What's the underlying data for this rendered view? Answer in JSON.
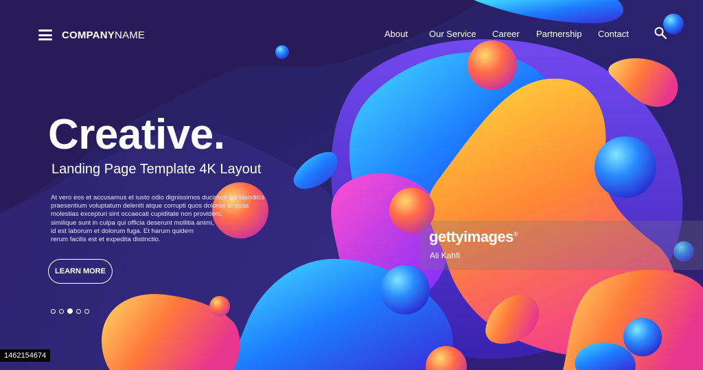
{
  "brand": {
    "bold": "COMPANY",
    "light": "NAME"
  },
  "nav": {
    "about": "About",
    "our_service": "Our Service",
    "career": "Career",
    "partnership": "Partnership",
    "contact": "Contact"
  },
  "icons": {
    "menu": "hamburger-menu-icon",
    "search": "search-icon"
  },
  "hero": {
    "headline": "Creative.",
    "subheadline": "Landing Page Template 4K Layout",
    "body_lines": [
      "At vero eos et accusamus et iusto odio dignissimos ducimus qui blanditiis",
      "praesentium voluptatum deleniti atque corrupti quos dolores et quas",
      "molestias excepturi sint occaecati cupiditate non provident,",
      "similique sunt in culpa qui officia deserunt mollitia animi,",
      "id est laborum et dolorum fuga. Et harum quidem",
      "rerum facilis est et expedita distinctio."
    ],
    "cta_label": "LEARN MORE"
  },
  "carousel": {
    "count": 5,
    "active_index": 2
  },
  "watermark": {
    "brand": "gettyimages",
    "registered": "®",
    "author": "Ali Kahfi"
  },
  "image_id": "1462154674",
  "colors": {
    "background": "#2a1f63",
    "blue": "#1f6bff",
    "cyan": "#2fc8ff",
    "magenta": "#d64cff",
    "orange": "#ff7b3b",
    "yellow": "#ffc53a",
    "pink": "#ff4f8b"
  }
}
